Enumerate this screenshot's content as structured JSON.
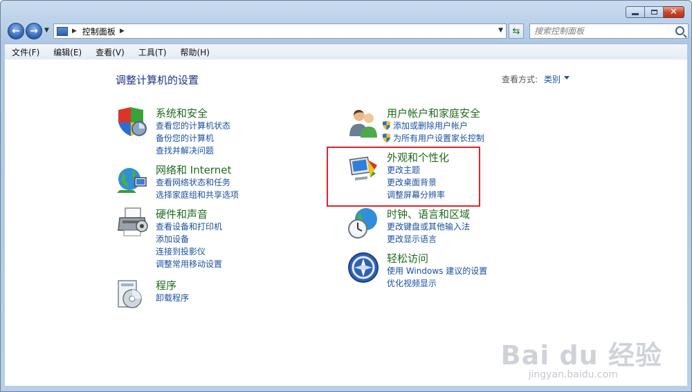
{
  "address": {
    "path": "控制面板"
  },
  "search": {
    "placeholder": "搜索控制面板"
  },
  "menu": [
    "文件(F)",
    "编辑(E)",
    "查看(V)",
    "工具(T)",
    "帮助(H)"
  ],
  "page": {
    "title": "调整计算机的设置",
    "view_by_label": "查看方式:",
    "view_by_value": "类别"
  },
  "categories": {
    "system": {
      "title": "系统和安全",
      "links": [
        "查看您的计算机状态",
        "备份您的计算机",
        "查找并解决问题"
      ]
    },
    "network": {
      "title": "网络和 Internet",
      "links": [
        "查看网络状态和任务",
        "选择家庭组和共享选项"
      ]
    },
    "hardware": {
      "title": "硬件和声音",
      "links": [
        "查看设备和打印机",
        "添加设备",
        "连接到投影仪",
        "调整常用移动设置"
      ]
    },
    "programs": {
      "title": "程序",
      "links": [
        "卸载程序"
      ]
    },
    "users": {
      "title": "用户帐户和家庭安全",
      "links": [
        "添加或删除用户帐户",
        "为所有用户设置家长控制"
      ]
    },
    "appearance": {
      "title": "外观和个性化",
      "links": [
        "更改主题",
        "更改桌面背景",
        "调整屏幕分辨率"
      ]
    },
    "clock": {
      "title": "时钟、语言和区域",
      "links": [
        "更改键盘或其他输入法",
        "更改显示语言"
      ]
    },
    "ease": {
      "title": "轻松访问",
      "links": [
        "使用 Windows 建议的设置",
        "优化视频显示"
      ]
    }
  },
  "watermark": {
    "brand": "Bai du 经验",
    "url": "jingyan.baidu.com"
  }
}
